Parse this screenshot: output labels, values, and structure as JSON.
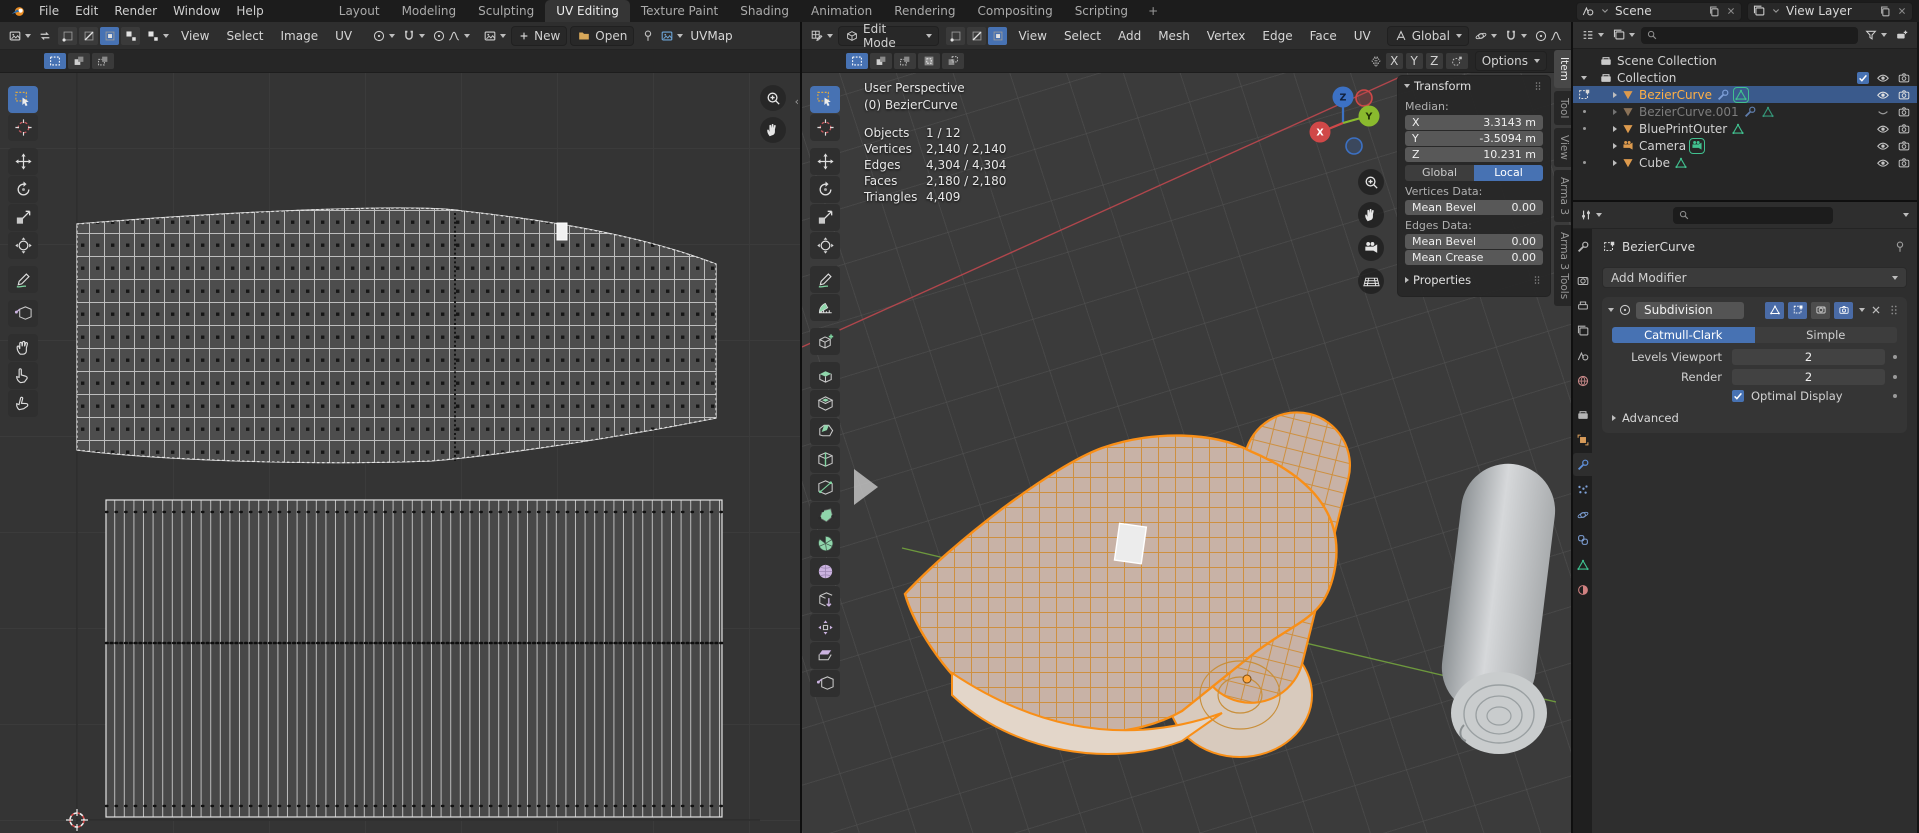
{
  "topbar": {
    "menus": [
      "File",
      "Edit",
      "Render",
      "Window",
      "Help"
    ],
    "workspaces": [
      "Layout",
      "Modeling",
      "Sculpting",
      "UV Editing",
      "Texture Paint",
      "Shading",
      "Animation",
      "Rendering",
      "Compositing",
      "Scripting"
    ],
    "active_workspace": "UV Editing",
    "add_workspace_label": "+",
    "scene_field": {
      "label": "Scene"
    },
    "view_layer_field": {
      "label": "View Layer"
    }
  },
  "uv_editor": {
    "menus": [
      "View",
      "Select",
      "Image",
      "UV"
    ],
    "buttons": {
      "new": "New",
      "open": "Open",
      "plus": "+"
    },
    "uv_map_label": "UVMap",
    "select_mode_icons": [
      "vertex",
      "edge",
      "face",
      "island"
    ],
    "active_select_mode": "face",
    "box_select_modes": [
      "new",
      "extend",
      "subtract"
    ],
    "tools": [
      "tweak-select",
      "cursor-2d",
      "move",
      "rotate",
      "scale",
      "transform",
      "annotate",
      "rip-region",
      "grab",
      "relax",
      "pinch"
    ]
  },
  "viewport": {
    "mode_label": "Edit Mode",
    "menus": [
      "View",
      "Select",
      "Add",
      "Mesh",
      "Vertex",
      "Edge",
      "Face",
      "UV"
    ],
    "orientation_label": "Global",
    "options_label": "Options",
    "mirror_axes": [
      "X",
      "Y",
      "Z"
    ],
    "select_mode_icons": [
      "vertex",
      "edge",
      "face"
    ],
    "active_select_mode": "face",
    "box_select_modes": [
      "new",
      "extend",
      "subtract",
      "invert",
      "intersect"
    ],
    "tools": [
      "tweak-select",
      "cursor-3d",
      "move",
      "rotate",
      "scale",
      "transform",
      "annotate",
      "measure",
      "add-cube",
      "extrude-region",
      "inset-faces",
      "bevel",
      "loop-cut",
      "knife",
      "poly-build",
      "spin",
      "smooth",
      "edge-slide",
      "shrink-fatten",
      "shear",
      "rip-region"
    ],
    "gizmo": {
      "x": "X",
      "y": "Y",
      "z": "Z"
    },
    "overlay": {
      "view_label": "User Perspective",
      "active_object": "(0) BezierCurve",
      "stats": [
        {
          "label": "Objects",
          "value": "1 / 12"
        },
        {
          "label": "Vertices",
          "value": "2,140 / 2,140"
        },
        {
          "label": "Edges",
          "value": "4,304 / 4,304"
        },
        {
          "label": "Faces",
          "value": "2,180 / 2,180"
        },
        {
          "label": "Triangles",
          "value": "4,409"
        }
      ]
    }
  },
  "sidebar": {
    "tabs": [
      "Item",
      "Tool",
      "View",
      "Arma 3",
      "Arma 3 Tools"
    ],
    "active_tab": "Item",
    "transform": {
      "title": "Transform",
      "median_label": "Median:",
      "axes": [
        {
          "axis": "X",
          "value": "3.3143 m"
        },
        {
          "axis": "Y",
          "value": "-3.5094 m"
        },
        {
          "axis": "Z",
          "value": "10.231 m"
        }
      ],
      "space_options": {
        "global": "Global",
        "local": "Local"
      },
      "active_space": "Local",
      "vertices_data_label": "Vertices Data:",
      "vertices_rows": [
        {
          "label": "Mean Bevel",
          "value": "0.00"
        }
      ],
      "edges_data_label": "Edges Data:",
      "edges_rows": [
        {
          "label": "Mean Bevel",
          "value": "0.00"
        },
        {
          "label": "Mean Crease",
          "value": "0.00"
        }
      ],
      "properties_label": "Properties"
    }
  },
  "outliner": {
    "items": [
      {
        "label": "Scene Collection",
        "icon": "collection"
      },
      {
        "label": "Collection",
        "icon": "collection",
        "checkbox": true
      },
      {
        "label": "BezierCurve",
        "icon": "mesh",
        "selected": true,
        "badges": [
          "modifier-wrench",
          "mesh-data"
        ]
      },
      {
        "label": "BezierCurve.001",
        "icon": "mesh",
        "hidden": true,
        "badges": [
          "modifier-wrench",
          "mesh-data"
        ]
      },
      {
        "label": "BluePrintOuter",
        "icon": "mesh",
        "badges": [
          "mesh-data"
        ]
      },
      {
        "label": "Camera",
        "icon": "camera",
        "badges": [
          "camera-data"
        ]
      },
      {
        "label": "Cube",
        "icon": "mesh",
        "badges": [
          "mesh-data"
        ]
      }
    ]
  },
  "properties": {
    "tabs": [
      "tool",
      "render",
      "output",
      "view-layer",
      "scene",
      "world",
      "collection",
      "object",
      "modifiers",
      "particles",
      "physics",
      "constraints",
      "object-data",
      "material"
    ],
    "active_tab": "modifiers",
    "breadcrumb_object": "BezierCurve",
    "add_modifier_label": "Add Modifier",
    "modifier": {
      "name": "Subdivision",
      "subdivision_types": [
        "Catmull-Clark",
        "Simple"
      ],
      "active_type": "Catmull-Clark",
      "rows": [
        {
          "label": "Levels Viewport",
          "value": "2"
        },
        {
          "label": "Render",
          "value": "2"
        }
      ],
      "optimal_display_label": "Optimal Display",
      "optimal_display_checked": true,
      "advanced_label": "Advanced"
    }
  },
  "colors": {
    "accent_blue": "#4772b3",
    "selected_row_blue": "#3a5a8c",
    "active_object_orange": "#ffaf45",
    "mesh_wire_orange": "#f98f17",
    "axis_x_red": "#c5484f",
    "axis_y_green": "#73a33e",
    "axis_z_blue": "#3c71c4"
  }
}
